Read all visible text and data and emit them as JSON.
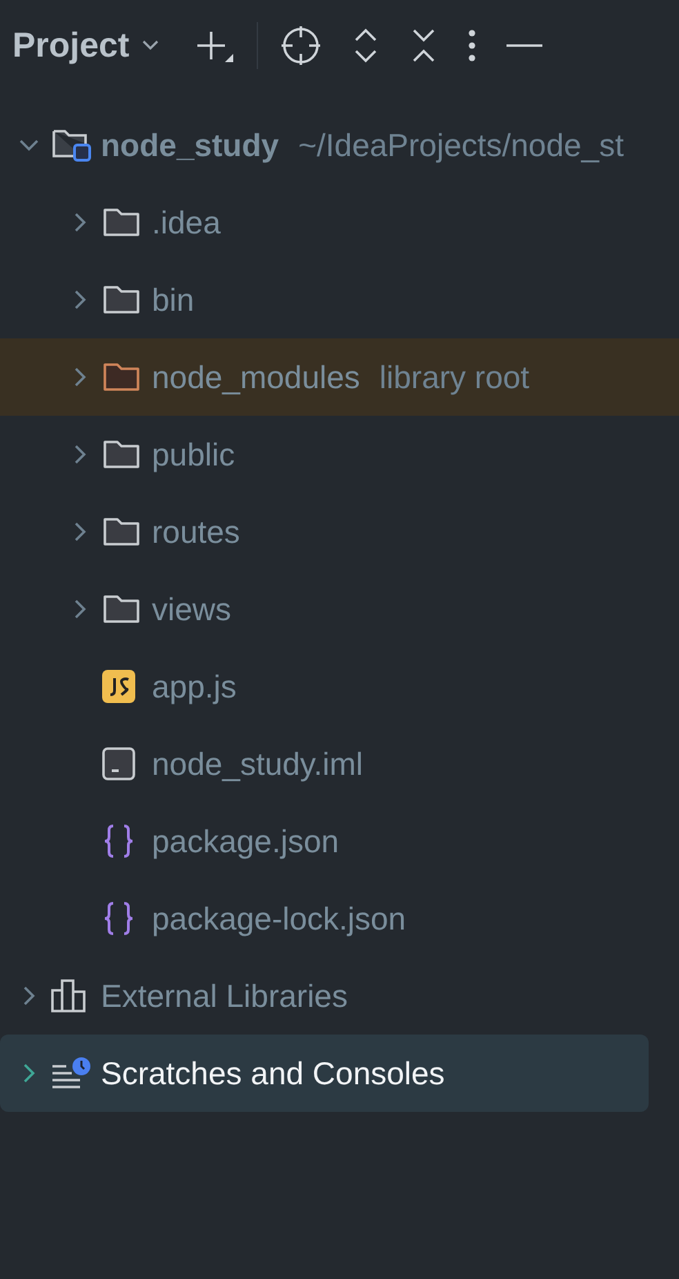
{
  "header": {
    "title": "Project"
  },
  "tree": [
    {
      "kind": "project",
      "name": "node_study",
      "path": "~/IdeaProjects/node_st",
      "expanded": true,
      "selected": false,
      "children": [
        {
          "kind": "folder",
          "name": ".idea",
          "expanded": false,
          "selected": false
        },
        {
          "kind": "folder",
          "name": "bin",
          "expanded": false,
          "selected": false
        },
        {
          "kind": "library-folder",
          "name": "node_modules",
          "path": "library root",
          "expanded": false,
          "selected": false
        },
        {
          "kind": "folder",
          "name": "public",
          "expanded": false,
          "selected": false
        },
        {
          "kind": "folder",
          "name": "routes",
          "expanded": false,
          "selected": false
        },
        {
          "kind": "folder",
          "name": "views",
          "expanded": false,
          "selected": false
        },
        {
          "kind": "js",
          "name": "app.js",
          "selected": false
        },
        {
          "kind": "iml",
          "name": "node_study.iml",
          "selected": false
        },
        {
          "kind": "json",
          "name": "package.json",
          "selected": false
        },
        {
          "kind": "json",
          "name": "package-lock.json",
          "selected": false
        }
      ]
    },
    {
      "kind": "libraries",
      "name": "External Libraries",
      "expanded": false,
      "selected": false
    },
    {
      "kind": "scratches",
      "name": "Scratches and Consoles",
      "expanded": false,
      "selected": true
    }
  ]
}
